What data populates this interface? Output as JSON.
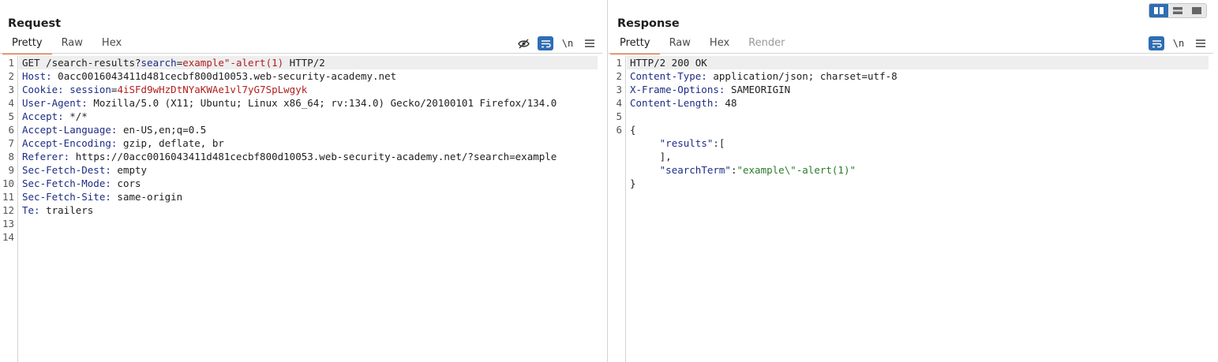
{
  "request": {
    "title": "Request",
    "tabs": [
      "Pretty",
      "Raw",
      "Hex"
    ],
    "active_tab": "Pretty",
    "tools": [
      "hide-nonprintable-icon",
      "wrap-lines-icon",
      "\\n",
      "menu-icon"
    ],
    "line_numbers": [
      "1",
      "2",
      "3",
      "4",
      "5",
      "6",
      "7",
      "8",
      "9",
      "10",
      "11",
      "12",
      "13",
      "14"
    ],
    "lines": {
      "l1_method": "GET ",
      "l1_path": "/search-results?",
      "l1_param_name": "search",
      "l1_eq": "=",
      "l1_param_value": "example\"-alert(1)",
      "l1_proto": " HTTP/2",
      "l2_name": "Host:",
      "l2_value": " 0acc0016043411d481cecbf800d10053.web-security-academy.net",
      "l3_name": "Cookie:",
      "l3_cookie_name": " session",
      "l3_eq": "=",
      "l3_cookie_value": "4iSFd9wHzDtNYaKWAe1vl7yG7SpLwgyk",
      "l4_name": "User-Agent:",
      "l4_value": " Mozilla/5.0 (X11; Ubuntu; Linux x86_64; rv:134.0) Gecko/20100101 Firefox/134.0",
      "l5_name": "Accept:",
      "l5_value": " */*",
      "l6_name": "Accept-Language:",
      "l6_value": " en-US,en;q=0.5",
      "l7_name": "Accept-Encoding:",
      "l7_value": " gzip, deflate, br",
      "l8_name": "Referer:",
      "l8_value": " https://0acc0016043411d481cecbf800d10053.web-security-academy.net/?search=example",
      "l9_name": "Sec-Fetch-Dest:",
      "l9_value": " empty",
      "l10_name": "Sec-Fetch-Mode:",
      "l10_value": " cors",
      "l11_name": "Sec-Fetch-Site:",
      "l11_value": " same-origin",
      "l12_name": "Te:",
      "l12_value": " trailers"
    }
  },
  "response": {
    "title": "Response",
    "tabs": [
      "Pretty",
      "Raw",
      "Hex",
      "Render"
    ],
    "active_tab": "Pretty",
    "tools": [
      "wrap-lines-icon",
      "\\n",
      "menu-icon"
    ],
    "line_numbers": [
      "1",
      "2",
      "3",
      "4",
      "5",
      "6"
    ],
    "lines": {
      "l1": "HTTP/2 200 OK",
      "l2_name": "Content-Type:",
      "l2_value": " application/json; charset=utf-8",
      "l3_name": "X-Frame-Options:",
      "l3_value": " SAMEORIGIN",
      "l4_name": "Content-Length:",
      "l4_value": " 48",
      "l6": "{",
      "l7_indent": "     ",
      "l7_key": "\"results\"",
      "l7_rest": ":[",
      "l8": "     ],",
      "l9_indent": "     ",
      "l9_key": "\"searchTerm\"",
      "l9_colon": ":",
      "l9_value": "\"example\\\"-alert(1)\"",
      "l10": "}"
    }
  },
  "layout_switch": [
    "split-horizontal-icon",
    "split-vertical-icon",
    "single-pane-icon"
  ],
  "colors": {
    "accent_tab": "#e8652a",
    "tool_active": "#2f6db3",
    "header_name": "#1c2c85",
    "param_value": "#b02020",
    "json_string": "#2a7a2a"
  }
}
